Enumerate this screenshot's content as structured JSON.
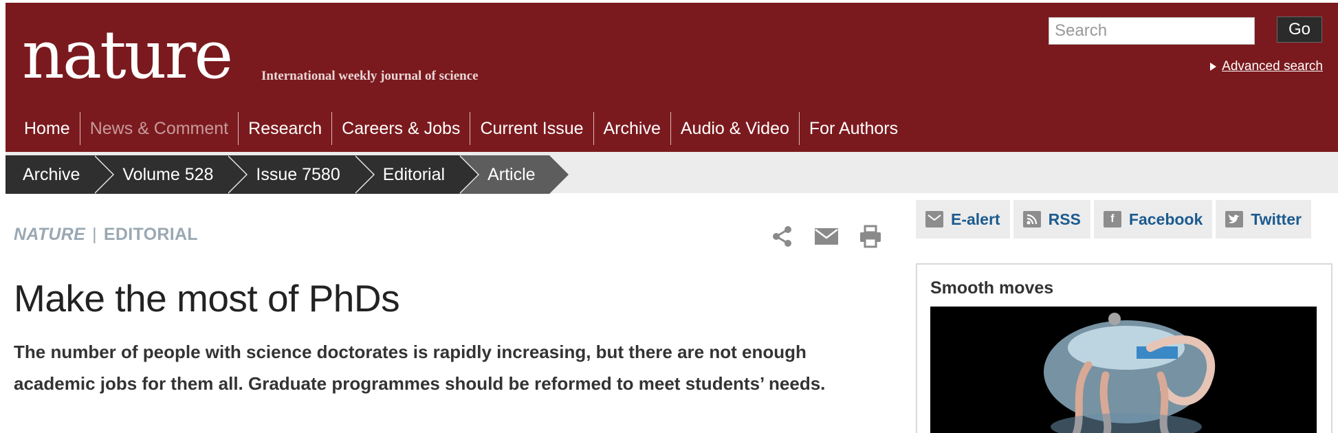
{
  "header": {
    "logo": "nature",
    "tagline": "International weekly journal of science",
    "search_placeholder": "Search",
    "go_label": "Go",
    "advanced_search": "Advanced search"
  },
  "nav": {
    "items": [
      {
        "label": "Home"
      },
      {
        "label": "News & Comment"
      },
      {
        "label": "Research"
      },
      {
        "label": "Careers & Jobs"
      },
      {
        "label": "Current Issue"
      },
      {
        "label": "Archive"
      },
      {
        "label": "Audio & Video"
      },
      {
        "label": "For Authors"
      }
    ]
  },
  "breadcrumb": [
    "Archive",
    "Volume 528",
    "Issue 7580",
    "Editorial",
    "Article"
  ],
  "article": {
    "journal": "NATURE",
    "separator": "|",
    "section": "EDITORIAL",
    "title": "Make the most of PhDs",
    "standfirst": "The number of people with science doctorates is rapidly increasing, but there are not enough academic jobs for them all. Graduate programmes should be reformed to meet students’ needs."
  },
  "tools": [
    "share-icon",
    "email-icon",
    "print-icon"
  ],
  "sidebar": {
    "social": [
      {
        "label": "E-alert",
        "icon": "envelope-icon"
      },
      {
        "label": "RSS",
        "icon": "rss-icon"
      },
      {
        "label": "Facebook",
        "icon": "facebook-icon"
      },
      {
        "label": "Twitter",
        "icon": "twitter-icon"
      }
    ],
    "promo_title": "Smooth moves"
  },
  "colors": {
    "brand": "#7b1a1e",
    "breadcrumb": "#2f2f2f",
    "link": "#1c5b8f",
    "kicker": "#9aa8b3"
  }
}
